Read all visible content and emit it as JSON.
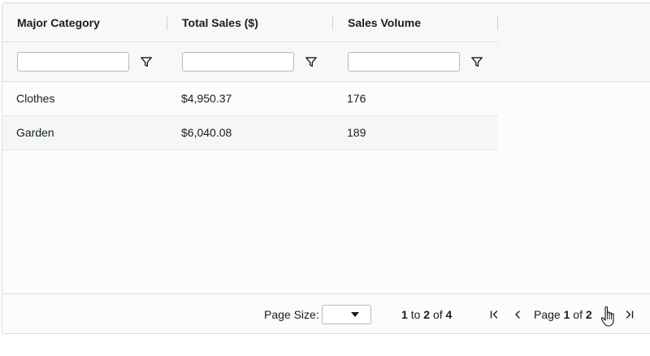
{
  "columns": [
    {
      "label": "Major Category",
      "filter_value": ""
    },
    {
      "label": "Total Sales ($)",
      "filter_value": ""
    },
    {
      "label": "Sales Volume",
      "filter_value": ""
    }
  ],
  "rows": [
    [
      "Clothes",
      "$4,950.37",
      "176"
    ],
    [
      "Garden",
      "$6,040.08",
      "189"
    ]
  ],
  "pager": {
    "page_size_label": "Page Size:",
    "page_size_value": "",
    "row_from": "1",
    "to_text": "to",
    "row_to": "2",
    "of_text": "of",
    "row_total": "4",
    "page_text": "Page",
    "page_current": "1",
    "page_total": "2"
  },
  "icons": {
    "filter": "filter-icon",
    "first": "first-page-icon",
    "previous": "previous-page-icon",
    "next": "next-page-icon",
    "last": "last-page-icon"
  }
}
